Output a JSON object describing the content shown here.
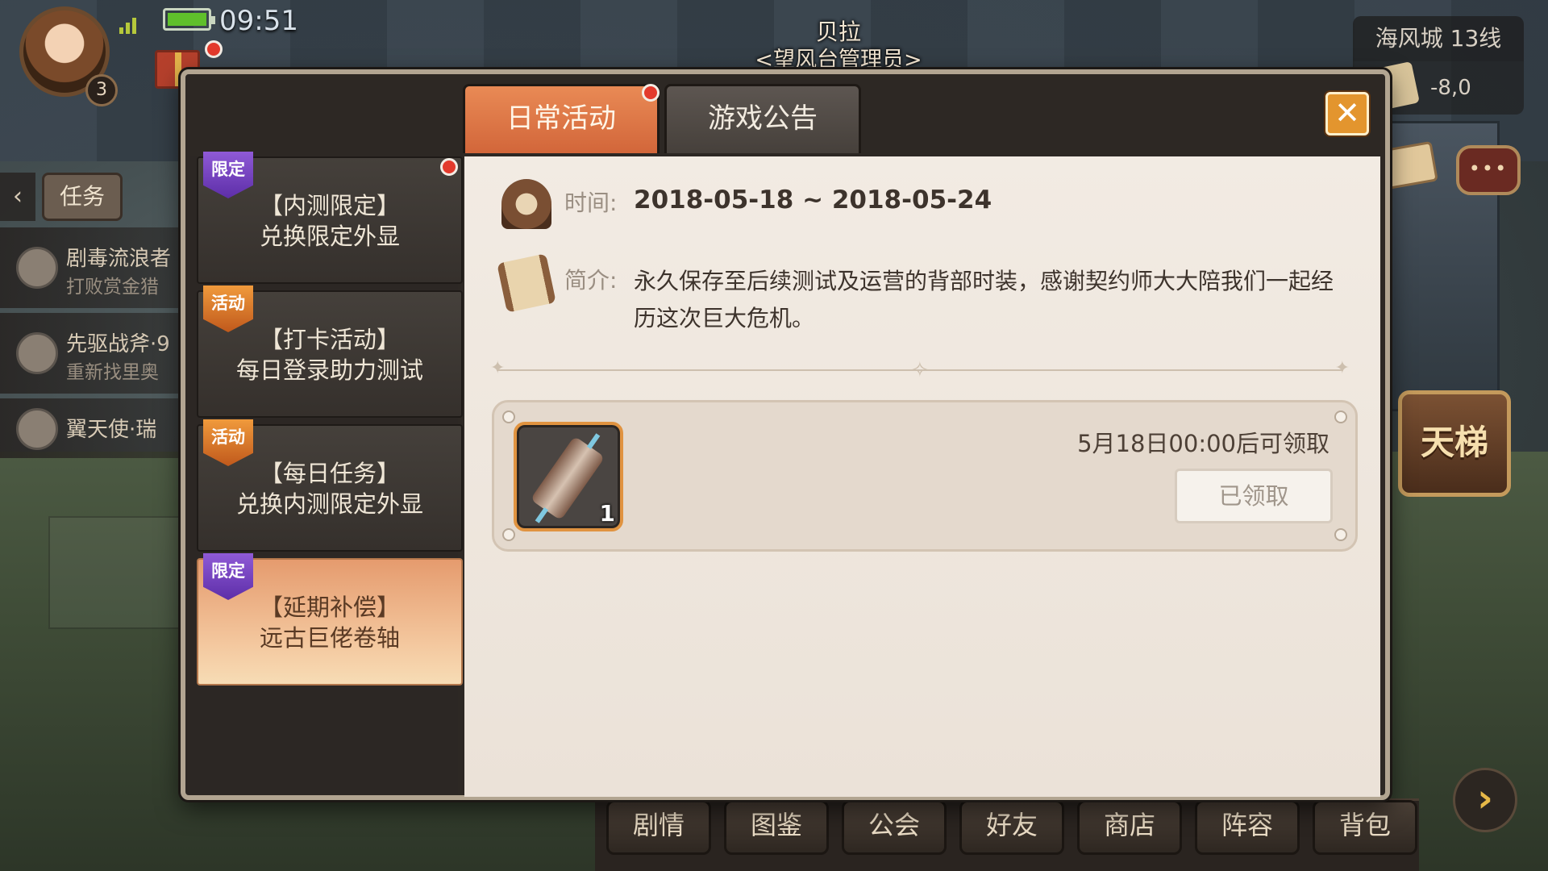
{
  "hud": {
    "clock": "09:51",
    "player_level": "3",
    "npc_name": "贝拉",
    "npc_title": "<望风台管理员>",
    "server": "海风城 13线",
    "coords": "-8,0"
  },
  "quest_panel": {
    "tab_label": "任务",
    "back_glyph": "‹",
    "items": [
      {
        "title": "剧毒流浪者",
        "subtitle": "打败赏金猎"
      },
      {
        "title": "先驱战斧·9",
        "subtitle": "重新找里奥"
      },
      {
        "title": "翼天使·瑞",
        "subtitle": ""
      }
    ]
  },
  "right_panel": {
    "ladder_label": "天梯",
    "chat_glyph": "•••",
    "next_glyph": "›"
  },
  "bottom_menu": [
    "剧情",
    "图鉴",
    "公会",
    "好友",
    "商店",
    "阵容",
    "背包"
  ],
  "dialog": {
    "tabs": [
      {
        "label": "日常活动",
        "active": true,
        "has_notice": true
      },
      {
        "label": "游戏公告",
        "active": false,
        "has_notice": false
      }
    ],
    "close_glyph": "✕",
    "sidebar": [
      {
        "badge": "限定",
        "badge_type": "limited",
        "label": "【内测限定】\n兑换限定外显",
        "active": false,
        "has_notice": true
      },
      {
        "badge": "活动",
        "badge_type": "event",
        "label": "【打卡活动】\n每日登录助力测试",
        "active": false,
        "has_notice": false
      },
      {
        "badge": "活动",
        "badge_type": "event",
        "label": "【每日任务】\n兑换内测限定外显",
        "active": false,
        "has_notice": false
      },
      {
        "badge": "限定",
        "badge_type": "limited",
        "label": "【延期补偿】\n远古巨佬卷轴",
        "active": true,
        "has_notice": false
      }
    ],
    "detail": {
      "time_label": "时间:",
      "time_value": "2018-05-18 ~ 2018-05-24",
      "desc_label": "简介:",
      "desc_text": "永久保存至后续测试及运营的背部时装，感谢契约师大大陪我们一起经历这次巨大危机。"
    },
    "reward": {
      "item_count": "1",
      "claim_time": "5月18日00:00后可领取",
      "button_label": "已领取"
    }
  },
  "colors": {
    "accent_orange": "#d2663a",
    "badge_limited": "#5d2ea8",
    "badge_event": "#c0591c",
    "notice_red": "#e33a2c"
  }
}
